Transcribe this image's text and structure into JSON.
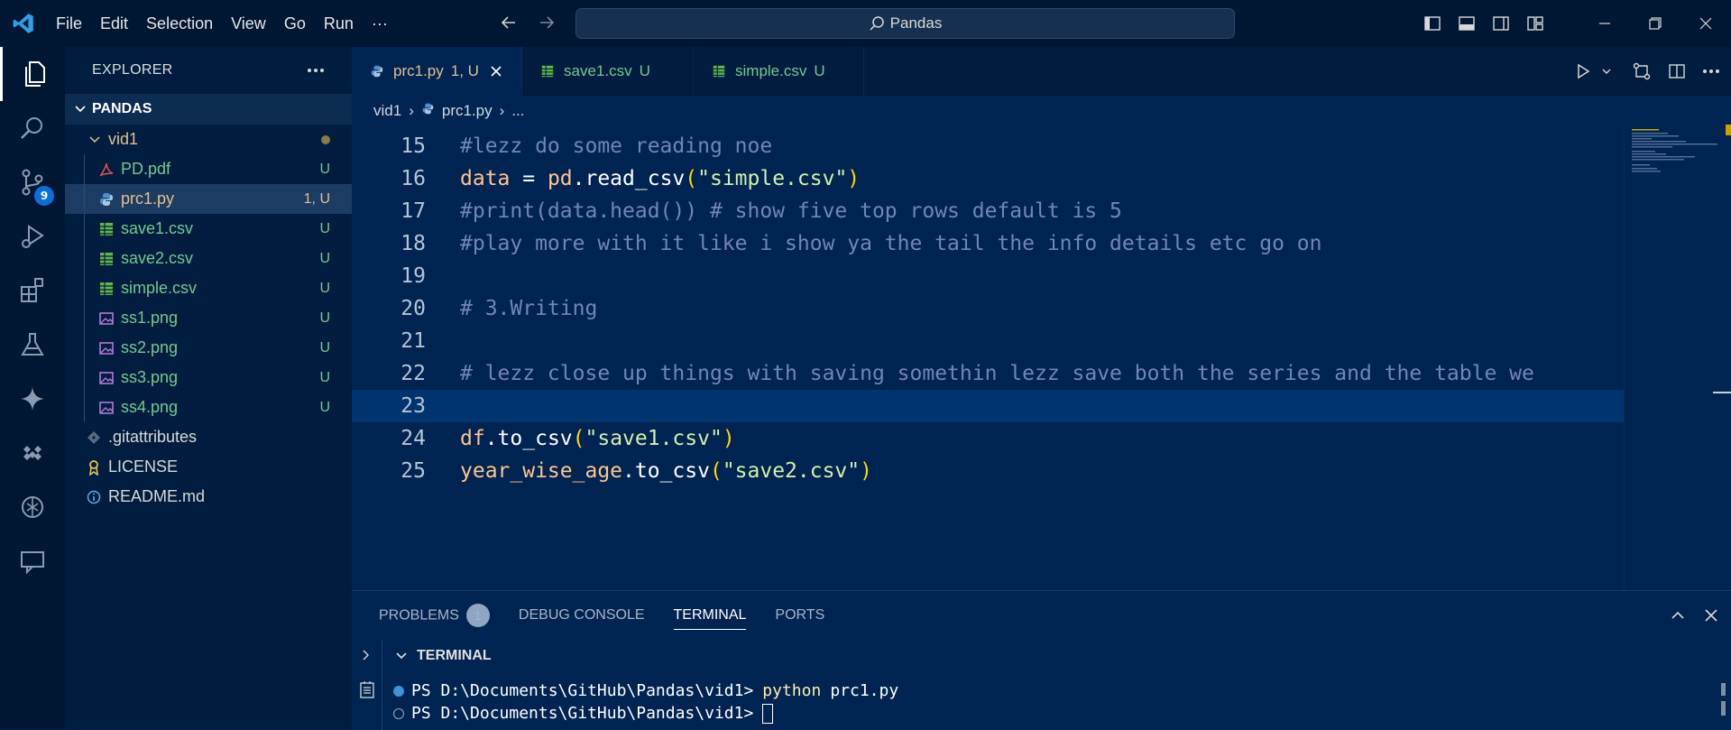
{
  "titlebar": {
    "menu": [
      "File",
      "Edit",
      "Selection",
      "View",
      "Go",
      "Run",
      "···"
    ],
    "search_text": "Pandas"
  },
  "activity": {
    "source_control_badge": "9"
  },
  "explorer": {
    "header": "EXPLORER",
    "section": "PANDAS",
    "folder": "vid1",
    "files": [
      {
        "name": "PD.pdf",
        "status": "U",
        "icon": "pdf-icon"
      },
      {
        "name": "prc1.py",
        "status": "1, U",
        "icon": "python-icon"
      },
      {
        "name": "save1.csv",
        "status": "U",
        "icon": "csv-icon"
      },
      {
        "name": "save2.csv",
        "status": "U",
        "icon": "csv-icon"
      },
      {
        "name": "simple.csv",
        "status": "U",
        "icon": "csv-icon"
      },
      {
        "name": "ss1.png",
        "status": "U",
        "icon": "image-icon"
      },
      {
        "name": "ss2.png",
        "status": "U",
        "icon": "image-icon"
      },
      {
        "name": "ss3.png",
        "status": "U",
        "icon": "image-icon"
      },
      {
        "name": "ss4.png",
        "status": "U",
        "icon": "image-icon"
      }
    ],
    "root_files": [
      {
        "name": ".gitattributes",
        "icon": "git-icon"
      },
      {
        "name": "LICENSE",
        "icon": "license-icon"
      },
      {
        "name": "README.md",
        "icon": "info-icon"
      }
    ]
  },
  "tabs": [
    {
      "name": "prc1.py",
      "status": "1, U"
    },
    {
      "name": "save1.csv",
      "status": "U"
    },
    {
      "name": "simple.csv",
      "status": "U"
    }
  ],
  "breadcrumb": {
    "folder": "vid1",
    "file": "prc1.py",
    "more": "..."
  },
  "code": {
    "l15": {
      "num": "15",
      "text": "#lezz do some reading noe"
    },
    "l16": {
      "num": "16",
      "var": "data",
      "eq": " = ",
      "mod": "pd",
      "call": ".read_csv",
      "open": "(",
      "arg": "\"simple.csv\"",
      "close": ")"
    },
    "l17": {
      "num": "17",
      "text": "#print(data.head()) # show five top rows default is 5"
    },
    "l18": {
      "num": "18",
      "text": "#play more with it like i show ya the tail the info details etc go on"
    },
    "l19": {
      "num": "19"
    },
    "l20": {
      "num": "20",
      "text": "# 3.Writing"
    },
    "l21": {
      "num": "21"
    },
    "l22": {
      "num": "22",
      "text": "# lezz close up things with saving somethin lezz save both the series and the table we"
    },
    "l23": {
      "num": "23"
    },
    "l24": {
      "num": "24",
      "var": "df",
      "call": ".to_csv",
      "open": "(",
      "arg": "\"save1.csv\"",
      "close": ")"
    },
    "l25": {
      "num": "25",
      "var": "year_wise_age",
      "call": ".to_csv",
      "open": "(",
      "arg": "\"save2.csv\"",
      "close": ")"
    }
  },
  "panel": {
    "tabs": [
      "PROBLEMS",
      "DEBUG CONSOLE",
      "TERMINAL",
      "PORTS"
    ],
    "problems_count": "1",
    "terminal_header": "TERMINAL",
    "prompt": "PS D:\\Documents\\GitHub\\Pandas\\vid1>",
    "command_word": "python",
    "command_arg": "prc1.py"
  },
  "colors": {
    "background": "#002451",
    "accent": "#0a6edb",
    "untracked": "#73c991",
    "modified": "#e2c08d"
  }
}
